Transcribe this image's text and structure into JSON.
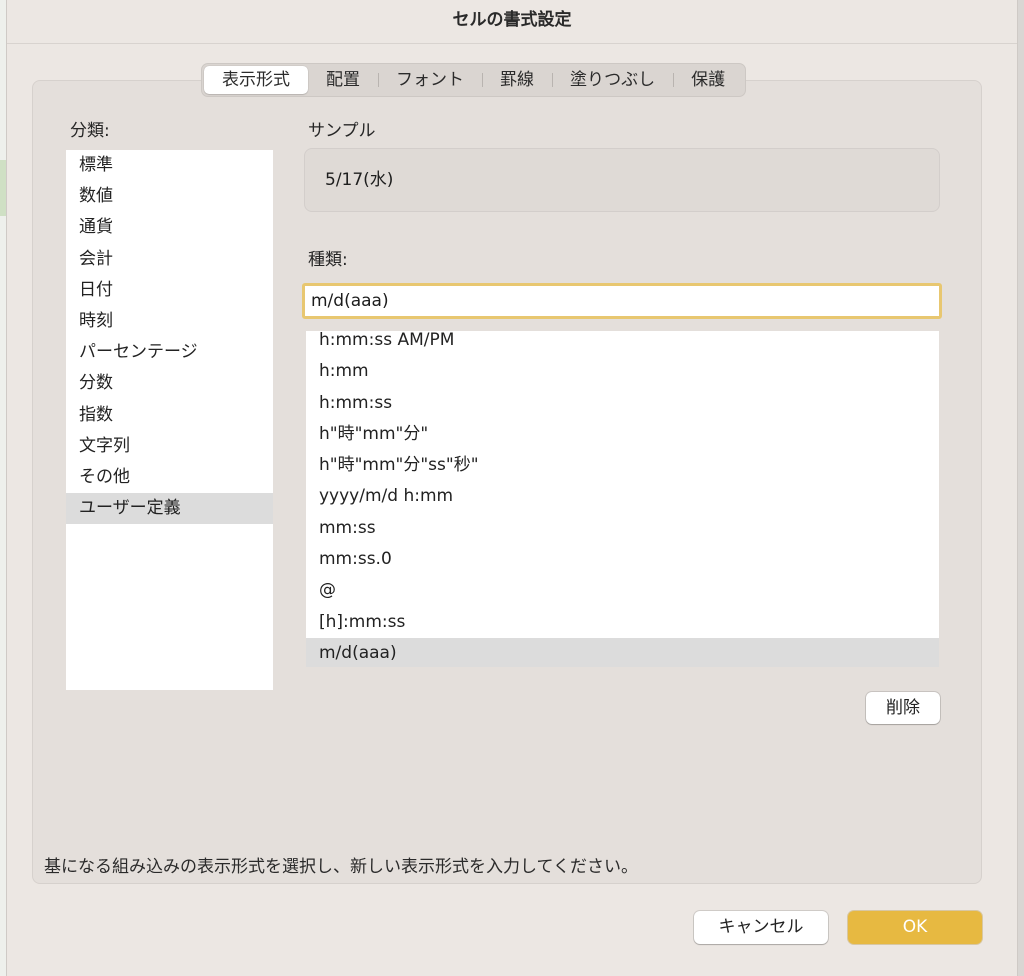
{
  "dialog": {
    "title": "セルの書式設定"
  },
  "tabs": [
    {
      "label": "表示形式",
      "active": true
    },
    {
      "label": "配置",
      "active": false
    },
    {
      "label": "フォント",
      "active": false
    },
    {
      "label": "罫線",
      "active": false
    },
    {
      "label": "塗りつぶし",
      "active": false
    },
    {
      "label": "保護",
      "active": false
    }
  ],
  "category": {
    "label": "分類:",
    "items": [
      "標準",
      "数値",
      "通貨",
      "会計",
      "日付",
      "時刻",
      "パーセンテージ",
      "分数",
      "指数",
      "文字列",
      "その他",
      "ユーザー定義"
    ],
    "selected": "ユーザー定義"
  },
  "sample": {
    "label": "サンプル",
    "value": "5/17(水)"
  },
  "type": {
    "label": "種類:",
    "input_value": "m/d(aaa)",
    "items": [
      "h:mm:ss AM/PM",
      "h:mm",
      "h:mm:ss",
      "h\"時\"mm\"分\"",
      "h\"時\"mm\"分\"ss\"秒\"",
      "yyyy/m/d h:mm",
      "mm:ss",
      "mm:ss.0",
      "@",
      "[h]:mm:ss",
      "m/d(aaa)"
    ],
    "selected": "m/d(aaa)"
  },
  "buttons": {
    "delete": "削除",
    "cancel": "キャンセル",
    "ok": "OK"
  },
  "hint": "基になる組み込みの表示形式を選択し、新しい表示形式を入力してください。",
  "colors": {
    "accent": "#e7b941",
    "input_focus": "#e8c770",
    "selection": "#dcdcdc"
  }
}
